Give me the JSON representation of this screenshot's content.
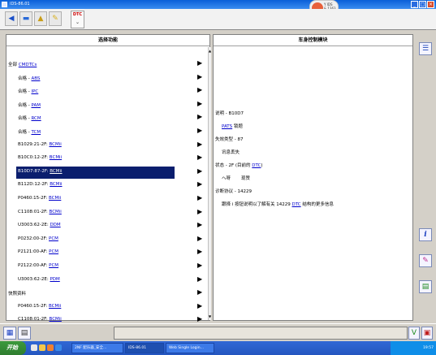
{
  "window": {
    "title": "IDS-86.01"
  },
  "logo": {
    "line1": "Y  IDS",
    "line2": "& 1363"
  },
  "toolbar": {
    "dtc_label": "DTC"
  },
  "left_panel": {
    "header": "选择功能",
    "rows": [
      {
        "pre": "全部 ",
        "link": "CMDTCs",
        "post": ""
      },
      {
        "pre": "合格 - ",
        "link": "ABS",
        "post": ""
      },
      {
        "pre": "合格 - ",
        "link": "IPC",
        "post": ""
      },
      {
        "pre": "合格 - ",
        "link": "PAM",
        "post": ""
      },
      {
        "pre": "合格 - ",
        "link": "RCM",
        "post": ""
      },
      {
        "pre": "合格 - ",
        "link": "TCM",
        "post": ""
      },
      {
        "pre": "B1029:21-2F: ",
        "link": "BCMii",
        "post": ""
      },
      {
        "pre": "B10C0:12-2F: ",
        "link": "BCMii",
        "post": ""
      },
      {
        "pre": "B10D7:87-2F: ",
        "link": "BCMii",
        "post": ""
      },
      {
        "pre": "B112D:12-2F: ",
        "link": "BCMii",
        "post": ""
      },
      {
        "pre": "P0460:15-2F: ",
        "link": "BCMii",
        "post": ""
      },
      {
        "pre": "C1108:01-2F: ",
        "link": "BCMii",
        "post": ""
      },
      {
        "pre": "U3003:62-2E: ",
        "link": "DDM",
        "post": ""
      },
      {
        "pre": "P0232:00-2F: ",
        "link": "PCM",
        "post": ""
      },
      {
        "pre": "P2121:00-AF: ",
        "link": "PCM",
        "post": ""
      },
      {
        "pre": "P2122:00-AF: ",
        "link": "PCM",
        "post": ""
      },
      {
        "pre": "U3003:62-2E: ",
        "link": "PDM",
        "post": ""
      },
      {
        "pre": "快照资料",
        "link": "",
        "post": ""
      },
      {
        "pre": "P0460:15-2F: ",
        "link": "BCMii",
        "post": ""
      },
      {
        "pre": "C1108:01-2F: ",
        "link": "BCMii",
        "post": ""
      }
    ]
  },
  "right_panel": {
    "header": "车身控制模块",
    "desc_label": "说明 - B10D7",
    "pats_link": "PATS",
    "pats_text": " 锁题",
    "fault_type": "失效类型 - 87",
    "fault_desc": "讯息丢失",
    "status_pre": "状态 - 2F (目前的 ",
    "status_link": "DTC",
    "status_post": ")",
    "status_val1": "ヘ呀",
    "status_val2": "现赞",
    "protocol": "诊断协议 - 14229",
    "info_pre": "跟择 i 按钮说明以了解有关 14229 ",
    "info_link": "DTC",
    "info_post": " 结构的更多信息"
  },
  "taskbar": {
    "start": "开始",
    "tasks": [
      "2NF 配乐器_安全...",
      "IDS-86.01",
      "Web Single Login..."
    ],
    "clock": "19:57"
  }
}
